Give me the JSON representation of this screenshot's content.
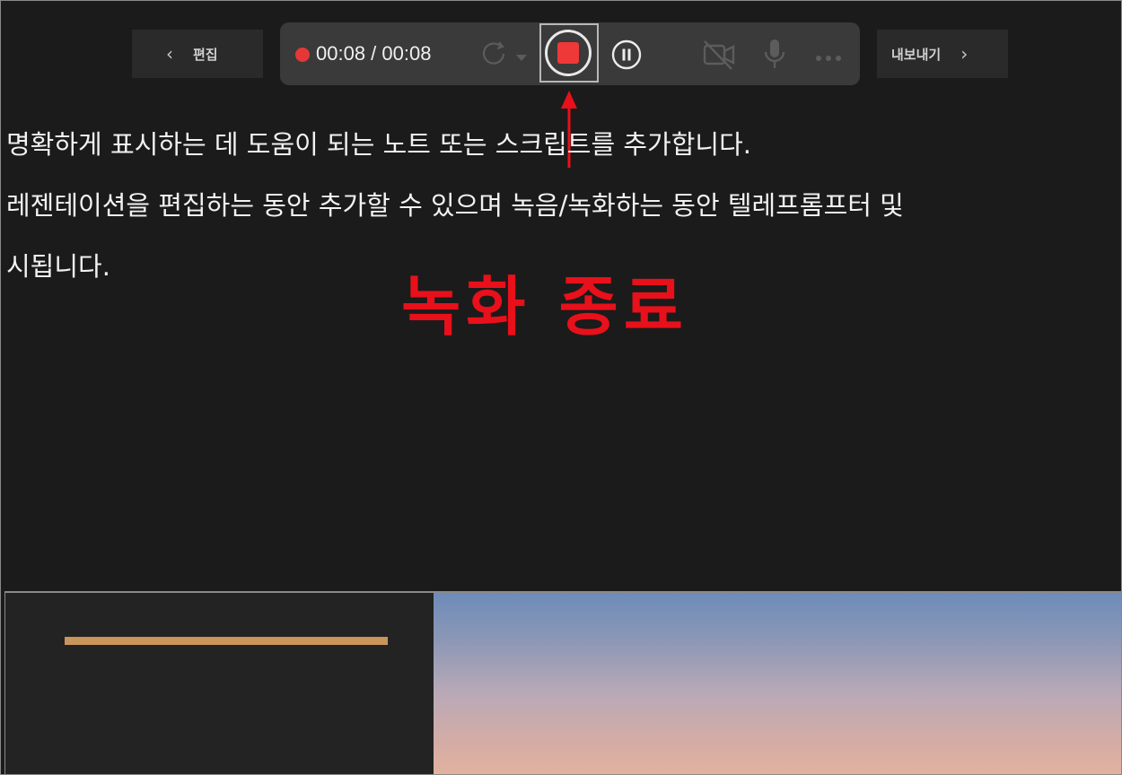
{
  "nav": {
    "back_label": "편집",
    "export_label": "내보내기"
  },
  "toolbar": {
    "timer": "00:08 / 00:08",
    "recording_color": "#e63737",
    "icons": [
      "recording-dot-icon",
      "retake-icon",
      "dropdown-icon",
      "stop-icon",
      "pause-icon",
      "camera-off-icon",
      "microphone-icon",
      "more-icon"
    ]
  },
  "annotation": {
    "label": "녹화 종료",
    "color": "#e8101a"
  },
  "notes": {
    "lines": [
      "명확하게 표시하는 데 도움이 되는 노트 또는 스크립트를 추가합니다.",
      "레젠테이션을 편집하는 동안 추가할 수 있으며 녹음/녹화하는 동안 텔레프롬프터 및",
      "시됩니다."
    ]
  },
  "preview": {
    "accent_color": "#c9955b"
  }
}
